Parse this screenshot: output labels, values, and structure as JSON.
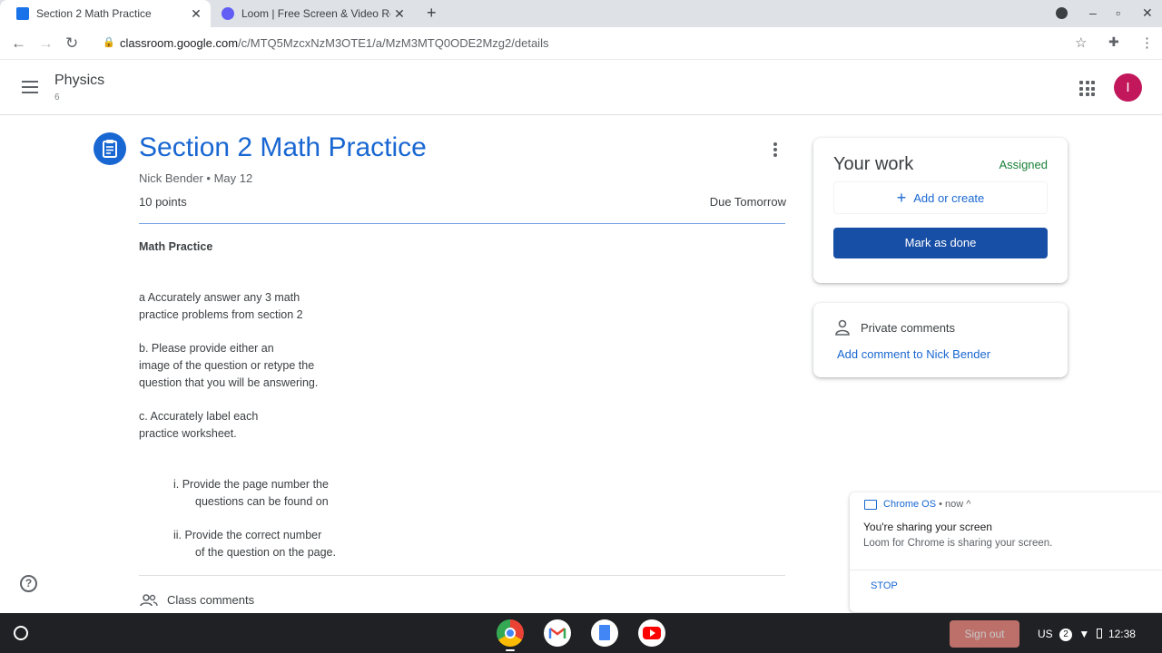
{
  "browser": {
    "tabs": [
      {
        "title": "Section 2 Math Practice",
        "active": true,
        "favicon_color": "#1a73e8"
      },
      {
        "title": "Loom | Free Screen & Video Re...",
        "active": false,
        "favicon_color": "#625df5"
      }
    ],
    "url_host": "classroom.google.com",
    "url_path": "/c/MTQ5MzcxNzM3OTE1/a/MzM3MTQ0ODE2Mzg2/details"
  },
  "header": {
    "class_name": "Physics",
    "section": "6",
    "avatar_initial": "I",
    "avatar_color": "#c2185b"
  },
  "assignment": {
    "title": "Section 2 Math Practice",
    "author_date": "Nick Bender • May 12",
    "points": "10 points",
    "due": "Due Tomorrow",
    "heading": "Math Practice",
    "lines": [
      "a      Accurately answer any 3 math",
      "practice problems from section 2",
      "b.      Please provide either an",
      "image of the question or retype the",
      "question that you will be answering.",
      "c.      Accurately label each",
      "practice worksheet.",
      "i.      Provide the page number the",
      "questions can be found on",
      "ii.      Provide the correct number",
      "of the question on the page."
    ],
    "class_comments": "Class comments"
  },
  "your_work": {
    "title": "Your work",
    "status": "Assigned",
    "add_label": "Add or create",
    "mark_done": "Mark as done"
  },
  "private_comments": {
    "title": "Private comments",
    "add_label": "Add comment to Nick Bender"
  },
  "notification": {
    "source": "Chrome OS",
    "time": "• now ^",
    "title": "You're sharing your screen",
    "body": "Loom for Chrome is sharing your screen.",
    "action": "STOP"
  },
  "shelf": {
    "sign_out": "Sign out",
    "ime": "US",
    "notif_count": "2",
    "time": "12:38"
  }
}
